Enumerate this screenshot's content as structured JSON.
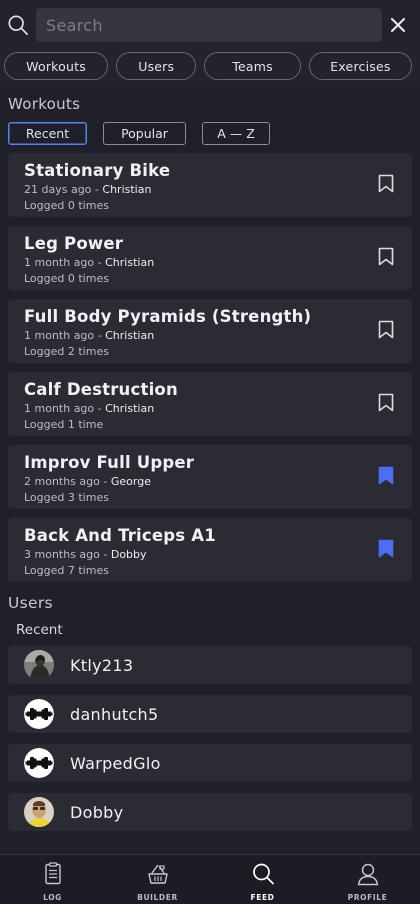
{
  "search": {
    "placeholder": "Search"
  },
  "tabs": [
    {
      "label": "Workouts"
    },
    {
      "label": "Users"
    },
    {
      "label": "Teams"
    },
    {
      "label": "Exercises"
    }
  ],
  "workouts": {
    "title": "Workouts",
    "filters": [
      {
        "label": "Recent",
        "active": true
      },
      {
        "label": "Popular",
        "active": false
      },
      {
        "label": "A — Z",
        "active": false
      }
    ],
    "items": [
      {
        "name": "Stationary Bike",
        "ago": "21 days ago",
        "author": "Christian",
        "logged": "Logged 0 times",
        "bookmarked": false
      },
      {
        "name": "Leg Power",
        "ago": "1 month ago",
        "author": "Christian",
        "logged": "Logged 0 times",
        "bookmarked": false
      },
      {
        "name": "Full Body Pyramids (Strength)",
        "ago": "1 month ago",
        "author": "Christian",
        "logged": "Logged 2 times",
        "bookmarked": false
      },
      {
        "name": "Calf Destruction",
        "ago": "1 month ago",
        "author": "Christian",
        "logged": "Logged 1 time",
        "bookmarked": false
      },
      {
        "name": "Improv Full Upper",
        "ago": "2 months ago",
        "author": "George",
        "logged": "Logged 3 times",
        "bookmarked": true
      },
      {
        "name": "Back And Triceps A1",
        "ago": "3 months ago",
        "author": "Dobby",
        "logged": "Logged 7 times",
        "bookmarked": true
      }
    ],
    "meta_separator": " - "
  },
  "users": {
    "title": "Users",
    "recent_label": "Recent",
    "items": [
      {
        "name": "Ktly213",
        "avatar": "photo-avatar"
      },
      {
        "name": "danhutch5",
        "avatar": "dumbbell-avatar"
      },
      {
        "name": "WarpedGlo",
        "avatar": "dumbbell-avatar"
      },
      {
        "name": "Dobby",
        "avatar": "face-avatar"
      }
    ]
  },
  "bottom_nav": [
    {
      "label": "LOG",
      "icon": "clipboard-icon",
      "active": false
    },
    {
      "label": "BUILDER",
      "icon": "builder-basket-icon",
      "active": false
    },
    {
      "label": "FEED",
      "icon": "search-icon",
      "active": true
    },
    {
      "label": "PROFILE",
      "icon": "person-icon",
      "active": false
    }
  ],
  "colors": {
    "accent": "#5a80f0",
    "bookmark_active": "#4d6df2",
    "background": "#1f2029",
    "card": "#2a2b33"
  }
}
